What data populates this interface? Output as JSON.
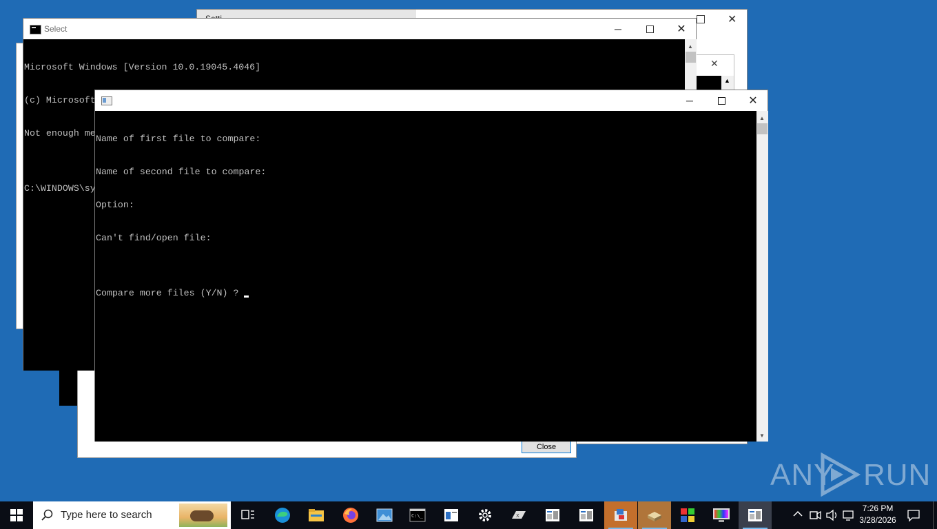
{
  "background_window": {
    "title_partial": "Setti",
    "inner_close": "✕",
    "dialog_button": "Close"
  },
  "cmd_window": {
    "title": "Select",
    "lines": [
      "Microsoft Windows [Version 10.0.19045.4046]",
      "(c) Microsoft Corporation. All rights reserved.",
      "Not enough memory resources are available to process this command.",
      "",
      "C:\\WINDOWS\\system32>"
    ]
  },
  "fc_window": {
    "title": "",
    "lines": [
      "Name of first file to compare:",
      "Name of second file to compare:",
      "Option:",
      "Can't find/open file:",
      "",
      "Compare more files (Y/N) ? "
    ]
  },
  "window_controls": {
    "minimize": "─",
    "maximize": "☐",
    "close": "✕"
  },
  "watermark": {
    "text_left": "ANY",
    "text_right": "RUN"
  },
  "taskbar": {
    "search_placeholder": "Type here to search",
    "clock_time": "7:26 PM",
    "clock_date": "3/28/2026",
    "icons": [
      "start-icon",
      "search-icon",
      "task-view-icon",
      "edge-icon",
      "file-explorer-icon",
      "firefox-icon",
      "photos-icon",
      "terminal-icon",
      "app-window-icon",
      "settings-icon",
      "tablet-icon",
      "document-icon",
      "document-icon",
      "installer-icon",
      "package-icon",
      "puzzle-icon",
      "monitor-icon",
      "console-app-icon"
    ]
  }
}
